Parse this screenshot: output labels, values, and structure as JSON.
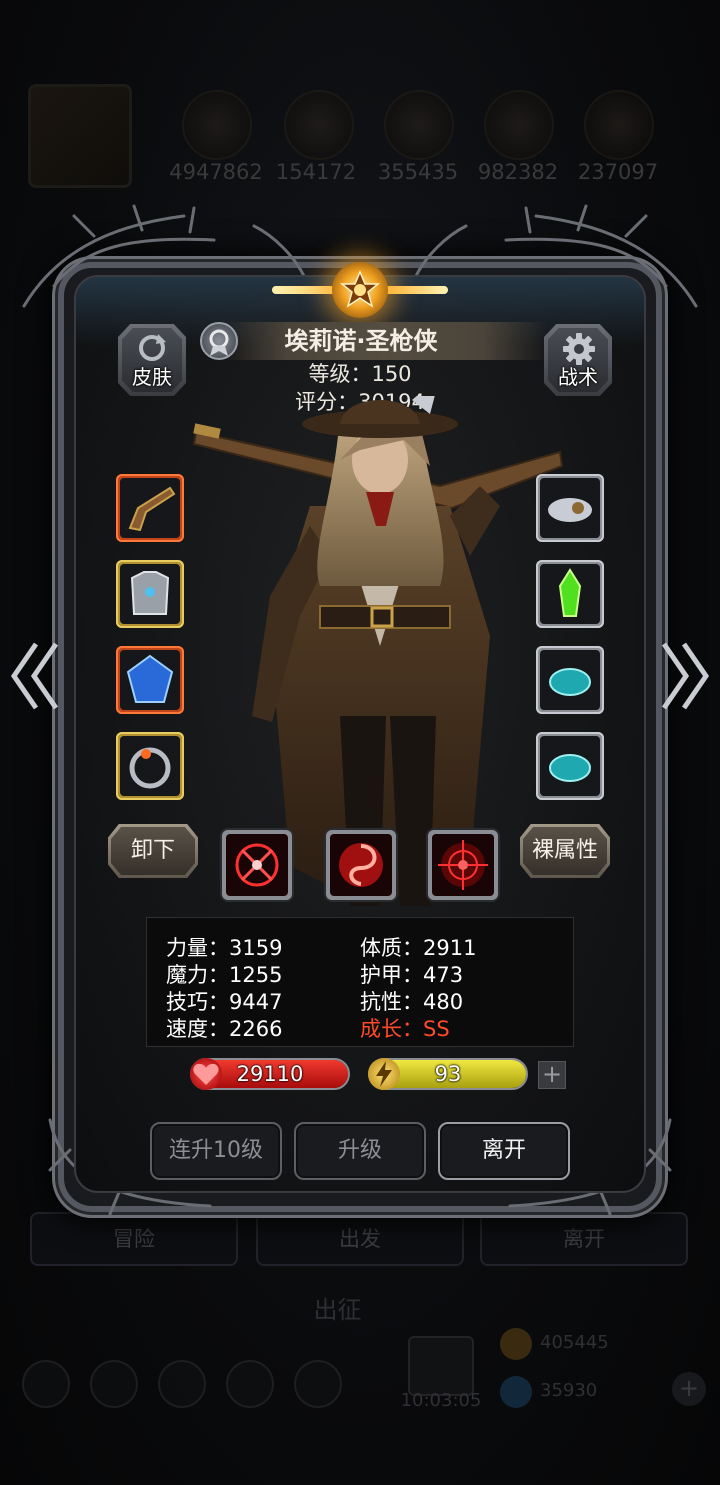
{
  "background": {
    "resources": [
      "4947862",
      "154172",
      "355435",
      "982382",
      "237097"
    ],
    "buttons": [
      "冒险",
      "出发",
      "离开"
    ],
    "sortie_label": "出征",
    "timer": "10:03:05",
    "currency": [
      "405445",
      "35930"
    ]
  },
  "hero": {
    "name": "埃莉诺·圣枪侠",
    "level_text": "等级：150",
    "score_text": "评分：30194"
  },
  "panel_buttons": {
    "skin": "皮肤",
    "tactics": "战术",
    "unequip": "卸下",
    "base_attr": "裸属性"
  },
  "equipment": {
    "left": [
      "flintlock-pistol-icon",
      "silver-armor-icon",
      "blue-gem-icon",
      "fire-ring-icon"
    ],
    "right": [
      "cloud-charm-icon",
      "green-crystal-icon",
      "teal-stone-icon",
      "teal-stone-icon"
    ]
  },
  "skills": [
    "crosshair-skill-icon",
    "vortex-skill-icon",
    "target-skill-icon"
  ],
  "stats": {
    "strength": "力量：3159",
    "constitution": "体质：2911",
    "magic": "魔力：1255",
    "armor": "护甲：473",
    "skill": "技巧：9447",
    "resistance": "抗性：480",
    "speed": "速度：2266",
    "growth": "成长：SS"
  },
  "bars": {
    "hp": "29110",
    "energy": "93",
    "hp_fill": 1.0,
    "energy_fill": 1.0,
    "plus": "+"
  },
  "actions": {
    "level_up_10": "连升10级",
    "level_up": "升级",
    "leave": "离开"
  },
  "colors": {
    "hp": "#d61c1c",
    "energy": "#d8d020",
    "growth": "#ff4a2a"
  }
}
